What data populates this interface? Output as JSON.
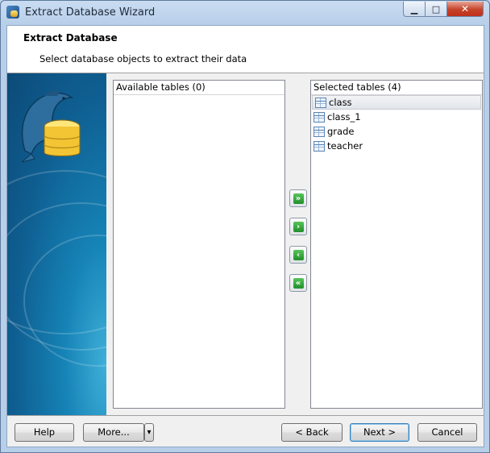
{
  "window": {
    "title": "Extract Database Wizard",
    "controls": {
      "minimize": "▁",
      "maximize": "□",
      "close": "✕"
    }
  },
  "header": {
    "title": "Extract Database",
    "subtitle": "Select database objects to extract their data"
  },
  "available": {
    "header": "Available tables (0)",
    "items": []
  },
  "selected": {
    "header": "Selected tables (4)",
    "items": [
      {
        "label": "class",
        "icon": "table-icon"
      },
      {
        "label": "class_1",
        "icon": "table-icon"
      },
      {
        "label": "grade",
        "icon": "table-icon"
      },
      {
        "label": "teacher",
        "icon": "table-icon"
      }
    ]
  },
  "move_buttons": {
    "add_all": "»",
    "add": "›",
    "remove": "‹",
    "remove_all": "«"
  },
  "footer": {
    "help": "Help",
    "more": "More...",
    "more_dropdown": "▾",
    "back": "< Back",
    "next": "Next >",
    "cancel": "Cancel"
  },
  "colors": {
    "accent": "#1683b6",
    "move_button_green": "#2fa53a"
  }
}
